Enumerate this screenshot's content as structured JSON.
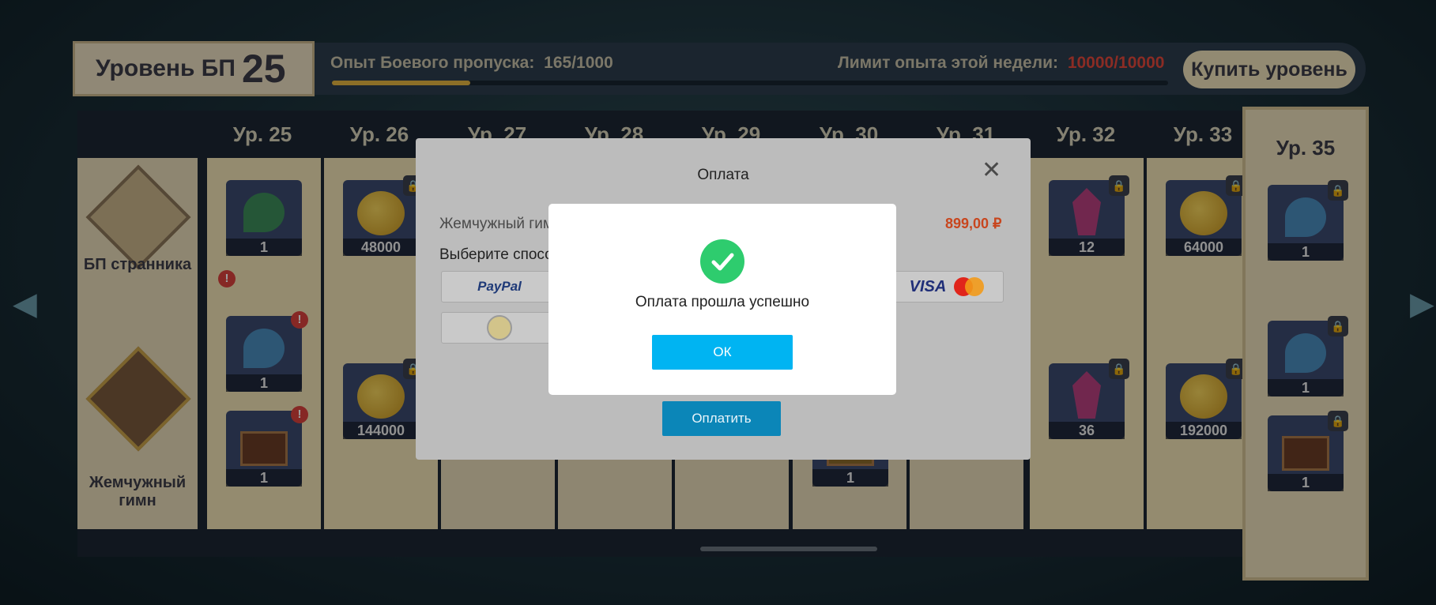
{
  "header": {
    "bp_level_label": "Уровень БП",
    "bp_level_value": "25",
    "exp_label": "Опыт Боевого пропуска:",
    "exp_value": "165/1000",
    "exp_progress": 0.165,
    "weekly_limit_label": "Лимит опыта этой недели:",
    "weekly_limit_value": "10000/10000",
    "buy_level_label": "Купить уровень"
  },
  "columns": [
    "Ур. 25",
    "Ур. 26",
    "Ур. 27",
    "Ур. 28",
    "Ур. 29",
    "Ур. 30",
    "Ур. 31",
    "Ур. 32",
    "Ур. 33"
  ],
  "side_column": {
    "label": "Ур. 35",
    "items": [
      "1",
      "1",
      "1"
    ]
  },
  "categories": {
    "free": "БП странника",
    "paid_line1": "Жемчужный",
    "paid_line2": "гимн"
  },
  "rewards": {
    "lv25_free": "1",
    "lv25_paid_1": "1",
    "lv25_paid_2": "1",
    "lv26_free": "48000",
    "lv26_paid": "144000",
    "lv30_paid": "1",
    "lv32_free": "12",
    "lv32_paid": "36",
    "lv33_free": "64000",
    "lv33_paid": "192000"
  },
  "alert_glyph": "!",
  "payment_dialog": {
    "title": "Оплата",
    "close_glyph": "✕",
    "product_name": "Жемчужный гимн",
    "price": "899,00 ₽",
    "choose_method": "Выберите способ оплаты",
    "paypal_label": "PayPal",
    "visa_label": "VISA",
    "pay_button": "Оплатить"
  },
  "success_dialog": {
    "message": "Оплата прошла успешно",
    "ok_button": "ОК"
  },
  "colors": {
    "ok_button": "#00b4f2",
    "pay_button": "#0b86b8",
    "check": "#2ecc6e",
    "price": "#c8461e"
  }
}
